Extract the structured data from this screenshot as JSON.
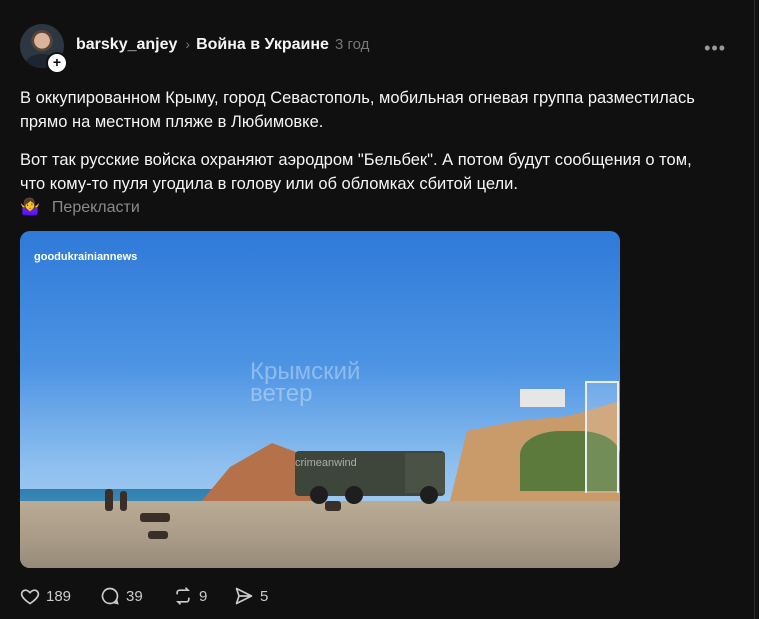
{
  "post": {
    "username": "barsky_anjey",
    "topic": "Война в Украине",
    "time": "3 год",
    "more_label": "•••",
    "paragraph1": "В оккупированном Крыму, город Севастополь, мобильная огневая группа разместилась прямо на местном пляже в Любимовке.",
    "paragraph2": "Вот так русские войска охраняют аэродром \"Бельбек\". А потом будут сообщения о том, что кому-то пуля угодила в голову или об обломках сбитой цели.",
    "translate_label": "Перекласти",
    "translate_emoji": "🤷‍♀️",
    "image_watermark_account": "goodukrainiannews",
    "image_watermark_brand": "Крымский\nветер",
    "image_watermark_handle": "crimeanwind"
  },
  "actions": {
    "likes": "189",
    "replies": "39",
    "reposts": "9",
    "shares": "5"
  },
  "icons": [
    "plus-icon",
    "chevron-right-icon",
    "more-icon",
    "heart-icon",
    "comment-icon",
    "repost-icon",
    "send-icon"
  ],
  "colors": {
    "background": "#101010",
    "text": "#f3f5f7",
    "muted": "#777777"
  }
}
